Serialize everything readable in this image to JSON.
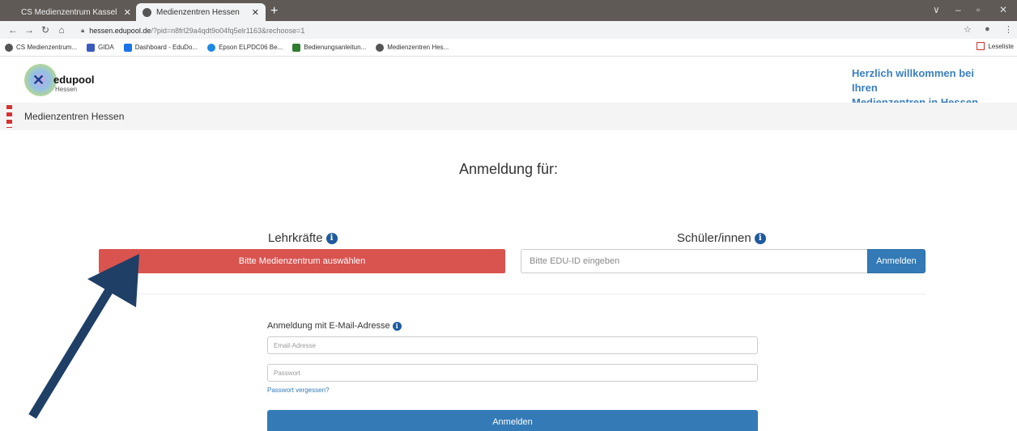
{
  "browser": {
    "tabs": [
      {
        "title": "CS Medienzentrum Kassel",
        "active": false
      },
      {
        "title": "Medienzentren Hessen",
        "active": true
      }
    ],
    "new_tab": "+",
    "window_controls": [
      "∨",
      "–",
      "▫",
      "✕"
    ],
    "url_host": "hessen.edupool.de",
    "url_path": "/?pid=n8frl29a4qdt9o04fq5elr1163&rechoose=1",
    "bookmarks": [
      {
        "label": "CS Medienzentrum...",
        "icon": "globe-icon",
        "color": "#555555"
      },
      {
        "label": "GIDA",
        "icon": "gida-icon",
        "color": "#3b5bbf"
      },
      {
        "label": "Dashboard - EduDo...",
        "icon": "edudocs-icon",
        "color": "#1a73e8"
      },
      {
        "label": "Epson ELPDC06 Be...",
        "icon": "epson-icon",
        "color": "#1e88e5"
      },
      {
        "label": "Bedienungsanleitun...",
        "icon": "search-doc-icon",
        "color": "#2e7d32"
      },
      {
        "label": "Medienzentren Hes...",
        "icon": "globe-icon",
        "color": "#555555"
      }
    ],
    "reading_list": "Leseliste"
  },
  "header": {
    "logo_text": "edupool",
    "logo_sub": "Hessen",
    "welcome_line1": "Herzlich willkommen bei Ihren",
    "welcome_line2": "Medienzentren in Hessen"
  },
  "breadcrumb": {
    "label": "Medienzentren Hessen"
  },
  "main": {
    "title": "Anmeldung für:",
    "teachers": {
      "label": "Lehrkräfte",
      "select_label": "Bitte Medienzentrum auswählen"
    },
    "students": {
      "label": "Schüler/innen",
      "placeholder": "Bitte EDU-ID eingeben",
      "button": "Anmelden"
    },
    "email_login": {
      "label": "Anmeldung mit E-Mail-Adresse",
      "email_placeholder": "Email-Adresse",
      "password_placeholder": "Passwort",
      "forgot": "Passwort vergessen?",
      "button": "Anmelden"
    }
  },
  "colors": {
    "accent_red": "#d9534f",
    "primary_blue": "#337ab7",
    "welcome_blue": "#3b7fbf",
    "annotation_arrow": "#1f3f66"
  }
}
